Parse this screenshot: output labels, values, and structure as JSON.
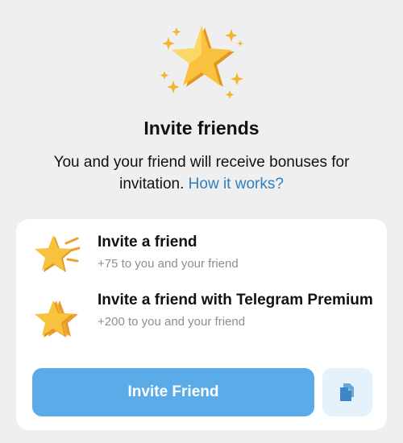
{
  "header": {
    "title": "Invite friends",
    "subtitle": "You and your friend will receive bonuses for invitation.",
    "link_label": "How it works?",
    "icon": "sparkling-star-icon"
  },
  "options": [
    {
      "title": "Invite a friend",
      "subtitle": "+75 to you and your friend",
      "icon": "star-icon"
    },
    {
      "title": "Invite a friend with Telegram Premium",
      "subtitle": "+200 to you and your friend",
      "icon": "stacked-stars-icon"
    }
  ],
  "actions": {
    "invite_label": "Invite Friend",
    "copy_icon": "copy-icon"
  },
  "colors": {
    "background": "#efefef",
    "accent": "#5aabe8",
    "link": "#2f7fbf",
    "star": "#f7b83a"
  }
}
